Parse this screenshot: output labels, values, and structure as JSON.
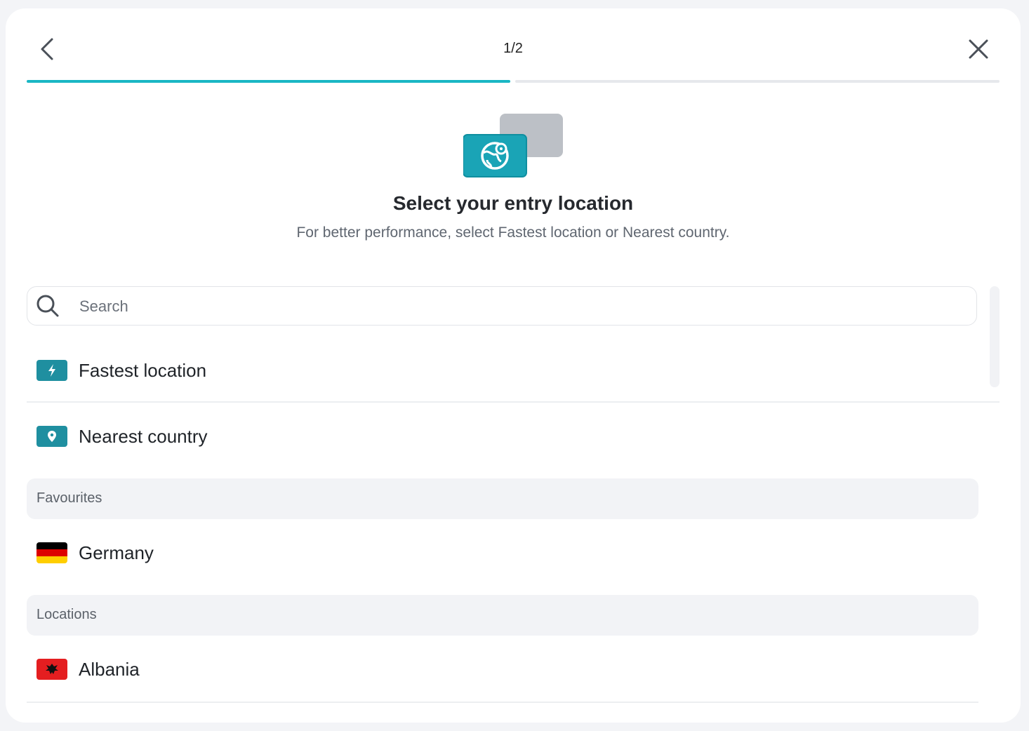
{
  "header": {
    "step": "1/2",
    "progress_fraction": 0.5,
    "back_icon": "chevron-left-icon",
    "close_icon": "close-icon"
  },
  "hero": {
    "icon": "globe-pin-icon",
    "title": "Select your entry location",
    "subtitle": "For better performance, select Fastest location or Nearest country."
  },
  "search": {
    "placeholder": "Search",
    "value": ""
  },
  "quick_options": [
    {
      "label": "Fastest location",
      "icon": "lightning-icon"
    },
    {
      "label": "Nearest country",
      "icon": "location-pin-icon"
    }
  ],
  "favourites": {
    "header": "Favourites",
    "items": [
      {
        "label": "Germany",
        "icon": "germany-flag-icon"
      }
    ]
  },
  "locations": {
    "header": "Locations",
    "items": [
      {
        "label": "Albania",
        "icon": "albania-flag-icon"
      }
    ]
  },
  "colors": {
    "accent": "#1ab7c4",
    "badge": "#1f8fa0",
    "section_bg": "#f2f3f6"
  }
}
